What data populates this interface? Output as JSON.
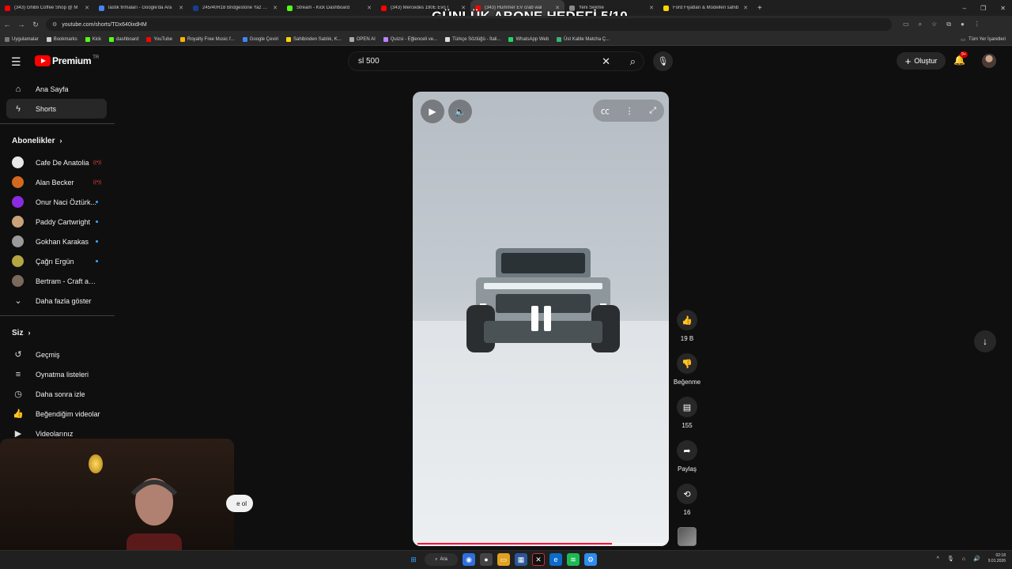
{
  "browser": {
    "tabs": [
      {
        "label": "(343) Ghibli Coffee Shop @ M",
        "color": "#ff0000"
      },
      {
        "label": "lastik firmaları - Google'da Ara",
        "color": "#4285f4"
      },
      {
        "label": "245/40R18 Bridgestone Yaz Las",
        "color": "#1a3c8f"
      },
      {
        "label": "Stream - Kick Dashboard",
        "color": "#53fc18"
      },
      {
        "label": "(343) Mercedes 190E Evo I",
        "color": "#ff0000"
      },
      {
        "label": "(343) Hummer EV crab wal",
        "color": "#ff0000",
        "active": true
      },
      {
        "label": "Yeni Sekme",
        "color": "#8a8a8a"
      },
      {
        "label": "Ford Fiyatları & Modelleri sahib",
        "color": "#ffd500"
      }
    ],
    "url": "youtube.com/shorts/TDx640ixdHM",
    "bookmarks": [
      {
        "label": "Uygulamalar",
        "color": "#777777"
      },
      {
        "label": "Bookmarks",
        "color": "#cccccc"
      },
      {
        "label": "Kick",
        "color": "#53fc18"
      },
      {
        "label": "dashboard",
        "color": "#53fc18"
      },
      {
        "label": "YouTube",
        "color": "#ff0000"
      },
      {
        "label": "Royalty Free Music f...",
        "color": "#ffb400"
      },
      {
        "label": "Google Çeviri",
        "color": "#4285f4"
      },
      {
        "label": "Sahibinden Satılık, K...",
        "color": "#ffd500"
      },
      {
        "label": "OPEN AI",
        "color": "#aaaaaa"
      },
      {
        "label": "Quizsi - Eğlenceli ve...",
        "color": "#c080ff"
      },
      {
        "label": "Türkçe Sözlüğü - İtali...",
        "color": "#dddddd"
      },
      {
        "label": "WhatsApp Web",
        "color": "#25d366"
      },
      {
        "label": "Üst Kalite Matcha Ç...",
        "color": "#3cb371"
      }
    ],
    "bookmarks_right": "Tüm Yer İşaretleri"
  },
  "overlay_title": "GÜNLÜK ABONE HEDEFİ 5/10",
  "header": {
    "logo_text": "Premium",
    "logo_region": "TR",
    "search_value": "sl 500",
    "create_label": "Oluştur",
    "notif_badge": "9+"
  },
  "sidebar": {
    "main": [
      {
        "label": "Ana Sayfa",
        "icon": "home-icon"
      },
      {
        "label": "Shorts",
        "icon": "shorts-icon",
        "active": true
      }
    ],
    "subs_title": "Abonelikler",
    "subscriptions": [
      {
        "name": "Cafe De Anatolia",
        "color": "#e8e8e8",
        "status": "live"
      },
      {
        "name": "Alan Becker",
        "color": "#d2691e",
        "status": "live"
      },
      {
        "name": "Onur Naci Öztürk...",
        "color": "#8a2be2",
        "status": "new"
      },
      {
        "name": "Paddy Cartwright",
        "color": "#c9a27a",
        "status": "new"
      },
      {
        "name": "Gokhan Karakas",
        "color": "#9a9a9a",
        "status": "new"
      },
      {
        "name": "Çağrı Ergün",
        "color": "#b5a642",
        "status": "new"
      },
      {
        "name": "Bertram - Craft and ...",
        "color": "#7a6a5a",
        "status": ""
      }
    ],
    "show_more": "Daha fazla göster",
    "you_title": "Siz",
    "you_items": [
      {
        "label": "Geçmiş",
        "icon": "history-icon"
      },
      {
        "label": "Oynatma listeleri",
        "icon": "playlist-icon"
      },
      {
        "label": "Daha sonra izle",
        "icon": "clock-icon"
      },
      {
        "label": "Beğendiğim videolar",
        "icon": "thumbs-up-icon"
      },
      {
        "label": "Videolarınız",
        "icon": "video-icon"
      }
    ]
  },
  "short": {
    "progress": 0.79
  },
  "actions": {
    "likes": "19 B",
    "dislike_label": "Beğenme",
    "comments": "155",
    "share_label": "Paylaş",
    "remix": "16"
  },
  "webcam": {
    "chip_text": "e ol"
  },
  "taskbar": {
    "search_label": "Ara",
    "time": "02:18",
    "date": "9.01.2026"
  }
}
